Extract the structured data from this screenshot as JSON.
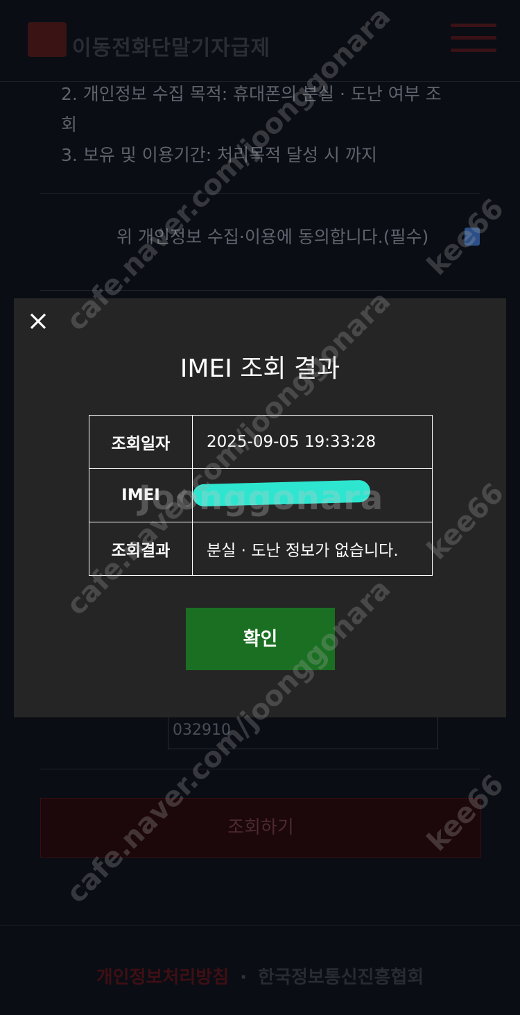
{
  "header": {
    "logo_text": "이동전화단말기자급제"
  },
  "background": {
    "terms": [
      "2. 개인정보 수집 목적: 휴대폰의 분실 · 도난 여부 조",
      "회",
      "3. 보유 및 이용기간: 처리목적 달성 시 까지"
    ],
    "agree_label": "위 개인정보 수집·이용에 동의합니다.(필수)",
    "code_value": "032910",
    "search_button": "조회하기"
  },
  "modal": {
    "title": "IMEI 조회 결과",
    "rows": [
      {
        "label": "조회일자",
        "value": "2025-09-05 19:33:28"
      },
      {
        "label": "IMEI",
        "value": ""
      },
      {
        "label": "조회결과",
        "value": "분실 · 도난 정보가 없습니다."
      }
    ],
    "ok_label": "확인",
    "close_icon": "close-icon"
  },
  "footer": {
    "privacy": "개인정보처리방침",
    "separator": "·",
    "org": "한국정보통신진흥협회"
  },
  "watermarks": {
    "url": "cafe.naver.com/joonggonara",
    "user": "kee66",
    "brand": "Joonggonara"
  }
}
